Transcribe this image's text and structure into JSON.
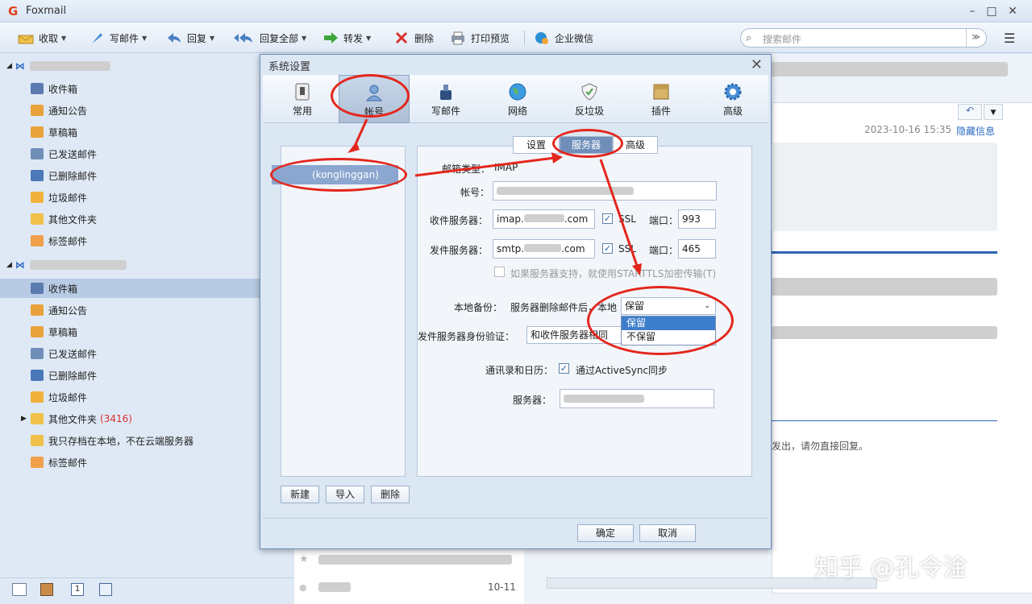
{
  "window": {
    "title": "Foxmail",
    "controls": [
      "minimize-icon",
      "maximize-icon",
      "close-icon"
    ]
  },
  "toolbar": {
    "receive": "收取",
    "compose": "写邮件",
    "reply": "回复",
    "reply_all": "回复全部",
    "forward": "转发",
    "delete": "删除",
    "print_preview": "打印预览",
    "wecom": "企业微信",
    "search_placeholder": "搜索邮件"
  },
  "sidebar": {
    "account1": {
      "folders": [
        "收件箱",
        "通知公告",
        "草稿箱",
        "已发送邮件",
        "已删除邮件",
        "垃圾邮件",
        "其他文件夹",
        "标签邮件"
      ]
    },
    "account2": {
      "folders": [
        "收件箱",
        "通知公告",
        "草稿箱",
        "已发送邮件",
        "已删除邮件",
        "垃圾邮件"
      ],
      "other_folders": "其他文件夹",
      "other_count": "(3416)",
      "local_folder": "我只存档在本地，不在云端服务器",
      "tag_folder": "标签邮件"
    }
  },
  "reading": {
    "datetime": "2023-10-16 15:35",
    "hide_info": "隐藏信息",
    "footer_text": "发出，请勿直接回复。"
  },
  "list": {
    "date": "10-11"
  },
  "dialog": {
    "title": "系统设置",
    "categories": [
      "常用",
      "帐号",
      "写邮件",
      "网络",
      "反垃圾",
      "插件",
      "高级"
    ],
    "account_name": "(konglinggan)",
    "tabs": [
      "设置",
      "服务器",
      "高级"
    ],
    "mail_type_label": "邮箱类型：",
    "mail_type_value": "IMAP",
    "account_label": "帐号：",
    "incoming_label": "收件服务器：",
    "incoming_value": "imap.",
    "incoming_suffix": ".com",
    "ssl": "SSL",
    "port_label": "端口：",
    "incoming_port": "993",
    "outgoing_label": "发件服务器：",
    "outgoing_value": "smtp.",
    "outgoing_suffix": ".com",
    "outgoing_port": "465",
    "starttls": "如果服务器支持，就使用STARTTLS加密传输(T)",
    "local_backup_label": "本地备份：",
    "local_backup_desc": "服务器删除邮件后，本地",
    "backup_selected": "保留",
    "backup_options": [
      "保留",
      "不保留"
    ],
    "auth_label": "发件服务器身份验证：",
    "auth_value": "和收件服务器相同",
    "contacts_label": "通讯录和日历：",
    "activesync": "通过ActiveSync同步",
    "server_label": "服务器：",
    "btn_new": "新建",
    "btn_import": "导入",
    "btn_delete": "删除",
    "btn_ok": "确定",
    "btn_cancel": "取消"
  },
  "watermark": "知乎 @孔令淦",
  "colors": {
    "accent": "#6f8fb8",
    "annotation_red": "#e4261c",
    "selection": "#3d7ecc",
    "badge_red": "#d9302b"
  }
}
